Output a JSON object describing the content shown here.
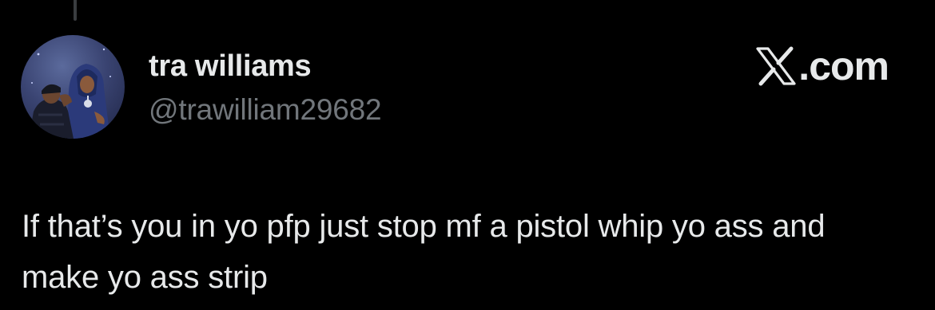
{
  "tweet": {
    "author_name": "tra williams",
    "author_handle": "@trawilliam29682",
    "avatar_icon": "profile-avatar",
    "brand": ".com",
    "brand_icon": "x-logo-icon",
    "text": "If that’s you in yo pfp just stop mf a pistol whip yo ass and make yo ass strip"
  },
  "colors": {
    "background": "#000000",
    "primary_text": "#e7e9ea",
    "secondary_text": "#71767b"
  }
}
